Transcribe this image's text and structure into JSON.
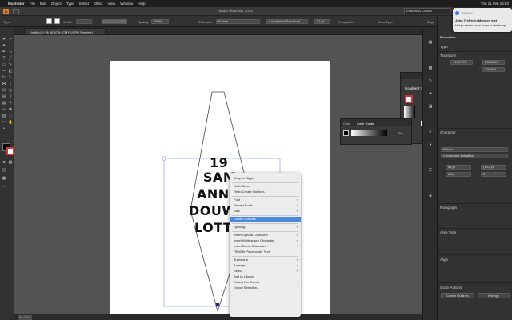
{
  "menubar": {
    "app": "Illustrator",
    "items": [
      "File",
      "Edit",
      "Object",
      "Type",
      "Select",
      "Effect",
      "View",
      "Window",
      "Help"
    ],
    "clock": "Thu 11 Feb 14:03"
  },
  "window": {
    "title": "Adobe Illustrator 2020",
    "workspace": "Essentials Classic"
  },
  "control": {
    "type_label": "Type",
    "stroke_label": "Stroke",
    "opacity_label": "Opacity:",
    "opacity_value": "100%",
    "character_label": "Character:",
    "font": "Futura",
    "style": "Condensed ExtraBold",
    "size": "51 pt",
    "paragraph_label": "Paragraph:",
    "area_type_label": "Area Type",
    "align_label": "Align",
    "transform_label": "Transform"
  },
  "document": {
    "tab": "Untitled-1* @ 66,67% (CMYK/CPU Preview)",
    "zoom": "66,67%"
  },
  "artwork": {
    "lines": [
      "19",
      "SAM",
      "ANNA",
      "DOUW",
      "LOTTA"
    ]
  },
  "notification": {
    "app": "SIGNAL",
    "title": "John Treffer in Mannen met",
    "body": "Het ja-tien is mooi maar d ziet er op."
  },
  "gradient_panel": {
    "title": "Gradient",
    "type_label": "Type:"
  },
  "color_panel": {
    "tabs": [
      "Color",
      "Color Guide"
    ],
    "value": "0%"
  },
  "properties": {
    "tabs": [
      "Properties",
      "Layers",
      "Libraries"
    ],
    "section_type": "Type",
    "section_transform": "Transform",
    "x": "145,1771",
    "y": "232,2867",
    "w": "208,864 r",
    "section_character": "Character",
    "font": "Futura",
    "style": "Condensed ExtraBold",
    "size": "51 pt",
    "leading": "(75,2 pt",
    "tracking": "Auto",
    "kerning": "0",
    "section_paragraph": "Paragraph",
    "section_area_type": "Area Type",
    "section_align": "Align",
    "section_quick": "Quick Actions",
    "btn_outlines": "Create Outlines",
    "btn_arrange": "Arrange"
  },
  "context_menu": {
    "items": [
      {
        "label": "Snap to Glyph",
        "sub": true
      },
      {
        "sep": true
      },
      {
        "label": "Undo Move"
      },
      {
        "label": "Redo Create Outlines"
      },
      {
        "sep": true
      },
      {
        "label": "Font",
        "sub": true
      },
      {
        "label": "Recent Fonts",
        "sub": true
      },
      {
        "label": "Size",
        "sub": true
      },
      {
        "sep": true
      },
      {
        "label": "Create Outlines",
        "hl": true
      },
      {
        "sep": true
      },
      {
        "label": "Spelling",
        "sub": true
      },
      {
        "sep": true
      },
      {
        "label": "Insert Special Character",
        "sub": true
      },
      {
        "label": "Insert Whitespace Character",
        "sub": true
      },
      {
        "label": "Insert Break Character",
        "sub": true
      },
      {
        "label": "Fill With Placeholder Text"
      },
      {
        "sep": true
      },
      {
        "label": "Transform",
        "sub": true
      },
      {
        "label": "Arrange",
        "sub": true
      },
      {
        "label": "Select",
        "sub": true
      },
      {
        "label": "Add to Library"
      },
      {
        "label": "Collect For Export",
        "sub": true
      },
      {
        "label": "Export Selection..."
      }
    ]
  },
  "colors": {
    "highlight": "#4a89dc",
    "canvas": "#535353"
  }
}
